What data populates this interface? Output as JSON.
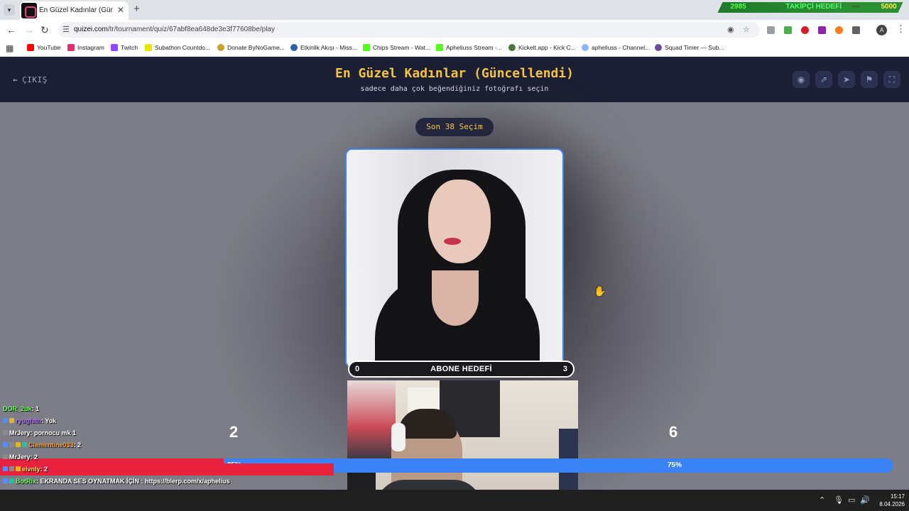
{
  "browser": {
    "tab_title": "En Güzel Kadınlar (Güncellendi)",
    "new_tab": "+",
    "url_host": "quizei.com",
    "url_path": "/tr/tournament/quiz/67abf8ea648de3e3f77608be/play",
    "bookmarks": [
      "YouTube",
      "Instagram",
      "Twitch",
      "Subathon Countdo...",
      "Donate ByNoGame...",
      "Etkinlik Akışı - Miss...",
      "Chips Stream - Wat...",
      "Apheliuss Stream -...",
      "Kickelt.app - Kick C...",
      "apheliuss - Channel...",
      "Squad Timer — Sub..."
    ],
    "profile_initial": "A"
  },
  "stream_goal": {
    "current": "2985",
    "label": "TAKİPÇİ HEDEFİ",
    "target": "5000"
  },
  "site": {
    "exit_label": "ÇIKIŞ",
    "title": "En Güzel Kadınlar (Güncellendi)",
    "subtitle": "sadece daha çok beğendiğiniz fotoğrafı seçin",
    "header_icons": [
      "eye-icon",
      "share-icon",
      "send-icon",
      "flag-icon",
      "fullscreen-icon"
    ]
  },
  "round": {
    "last_choice": "Son 38 Seçim",
    "left_score": "2",
    "right_score": "6",
    "left_pct_label": "25%",
    "right_pct_label": "75%",
    "left_fraction": 0.25
  },
  "sub_goal": {
    "current": "0",
    "label": "ABONE HEDEFİ",
    "target": "3"
  },
  "chat": [
    {
      "user": "DOR_2uk",
      "user_color": "#6cff5a",
      "text": ": 1",
      "badges": [],
      "highlight": false
    },
    {
      "user": "ryugfsth",
      "user_color": "#b16bff",
      "text": ": Yok",
      "badges": [
        "#5a8cff",
        "#e6b422"
      ],
      "highlight": false
    },
    {
      "user": "MrJery",
      "user_color": "#ffffff",
      "text": ": pornocu mk 1",
      "badges": [
        "#8a8a8a"
      ],
      "highlight": false
    },
    {
      "user": "Clementine033",
      "user_color": "#ff9f2e",
      "text": ": 2",
      "badges": [
        "#5a8cff",
        "#8a8a8a",
        "#e6b422",
        "#26c0a3"
      ],
      "highlight": false
    },
    {
      "user": "MrJery",
      "user_color": "#ffffff",
      "text": ": 2",
      "badges": [
        "#8a8a8a"
      ],
      "highlight": false
    },
    {
      "user": "elvnly",
      "user_color": "#ffe94d",
      "text": ": 2",
      "badges": [
        "#5a8cff",
        "#8a8a8a",
        "#e6b422"
      ],
      "highlight": true
    },
    {
      "user": "BotRix",
      "user_color": "#6cff5a",
      "text": ": EKRANDA SES OYNATMAK İÇİN : https://blerp.com/x/aphelius",
      "badges": [
        "#5a8cff",
        "#26c0a3"
      ],
      "highlight": false
    },
    {
      "user": "MrJery",
      "user_color": "#ffffff",
      "text": ":",
      "badges": [
        "#8a8a8a"
      ],
      "highlight": false
    }
  ],
  "taskbar": {
    "time": "15:17",
    "date": "8.04.2026"
  },
  "colors": {
    "accent_gold": "#f5c542",
    "vote_left": "#e8213f",
    "vote_right": "#3b82f6",
    "header_bg": "#1c1f33"
  }
}
